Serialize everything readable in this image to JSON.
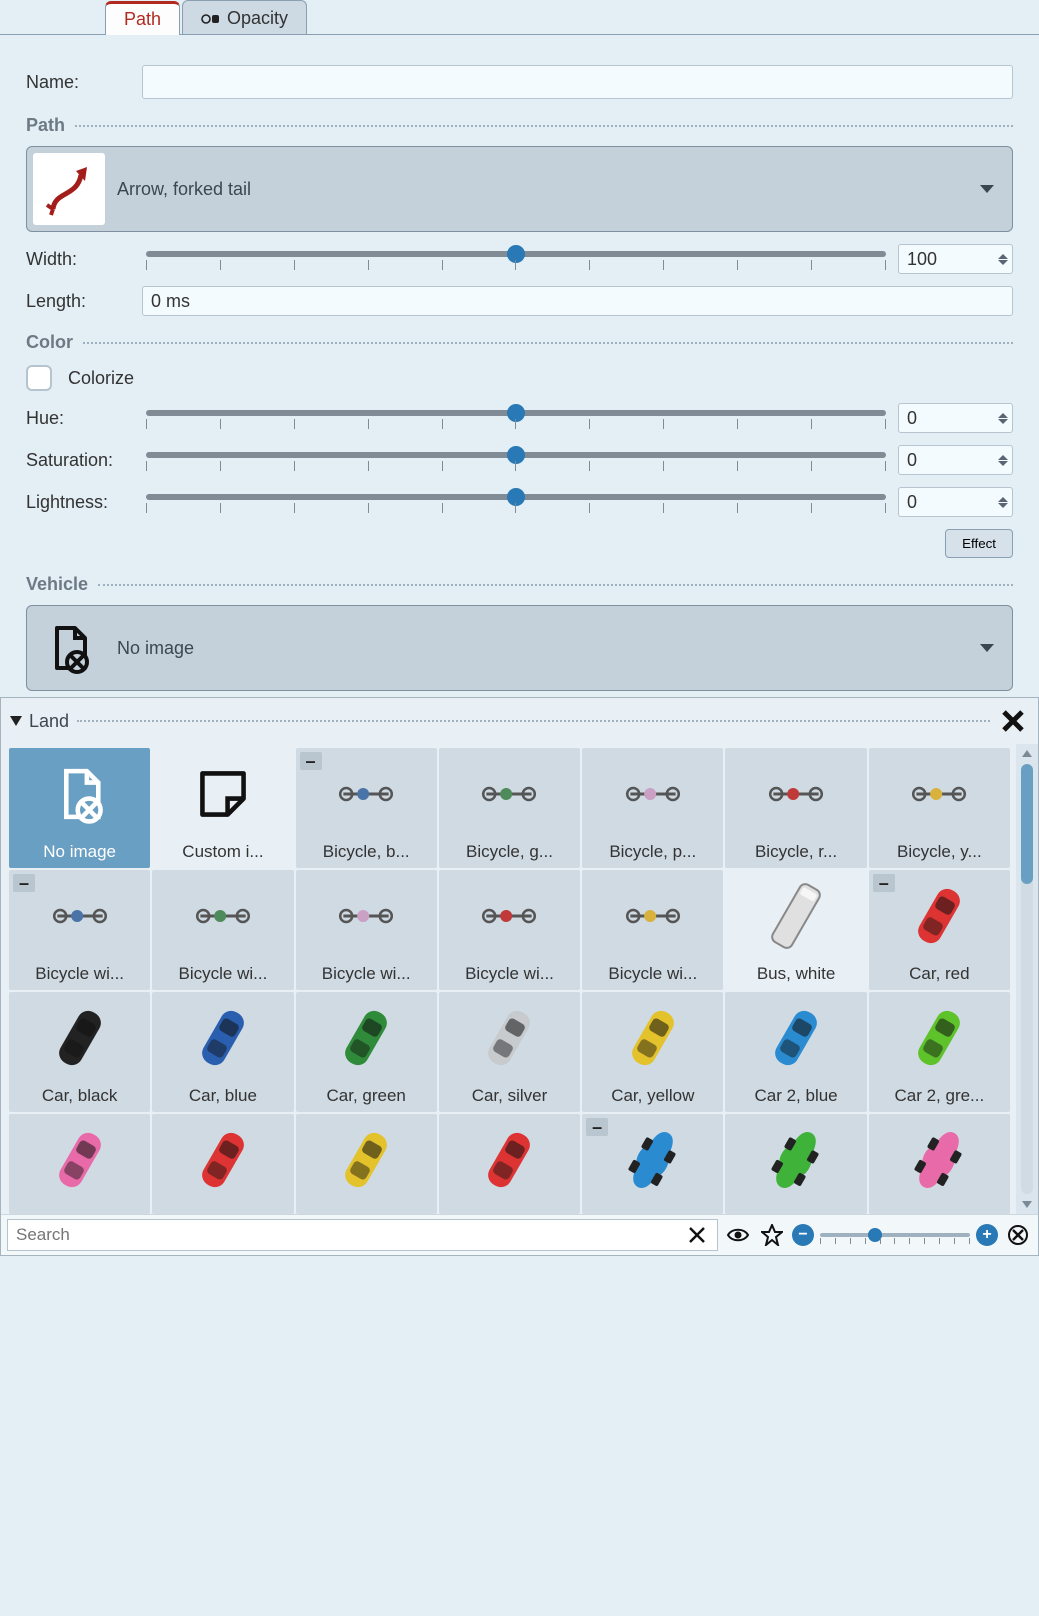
{
  "tabs": {
    "path": "Path",
    "opacity": "Opacity"
  },
  "fields": {
    "name_label": "Name:",
    "name_value": "",
    "width_label": "Width:",
    "width_value": "100",
    "length_label": "Length:",
    "length_value": "0 ms",
    "hue_label": "Hue:",
    "hue_value": "0",
    "sat_label": "Saturation:",
    "sat_value": "0",
    "light_label": "Lightness:",
    "light_value": "0",
    "colorize_label": "Colorize",
    "effect_label": "Effect"
  },
  "sections": {
    "path": "Path",
    "color": "Color",
    "vehicle": "Vehicle"
  },
  "dropdowns": {
    "path_style": "Arrow, forked tail",
    "vehicle_style": "No image"
  },
  "picker": {
    "category": "Land",
    "search_placeholder": "Search",
    "items": [
      {
        "label": "No image",
        "color": "",
        "selected": true,
        "kind": "noimage"
      },
      {
        "label": "Custom i...",
        "color": "",
        "light": true,
        "kind": "custom"
      },
      {
        "label": "Bicycle, b...",
        "color": "#4a74a8",
        "minus": true,
        "rotate": 45,
        "kind": "bike"
      },
      {
        "label": "Bicycle, g...",
        "color": "#4f8b5a",
        "rotate": 45,
        "kind": "bike"
      },
      {
        "label": "Bicycle, p...",
        "color": "#caa0c4",
        "rotate": 45,
        "kind": "bike"
      },
      {
        "label": "Bicycle, r...",
        "color": "#c03a3a",
        "rotate": 45,
        "kind": "bike"
      },
      {
        "label": "Bicycle, y...",
        "color": "#d8b23c",
        "rotate": 45,
        "kind": "bike"
      },
      {
        "label": "Bicycle wi...",
        "color": "#4a74a8",
        "minus": true,
        "rotate": 45,
        "kind": "bike"
      },
      {
        "label": "Bicycle wi...",
        "color": "#4f8b5a",
        "rotate": 45,
        "kind": "bike"
      },
      {
        "label": "Bicycle wi...",
        "color": "#caa0c4",
        "rotate": 45,
        "kind": "bike"
      },
      {
        "label": "Bicycle wi...",
        "color": "#c03a3a",
        "rotate": 45,
        "kind": "bike"
      },
      {
        "label": "Bicycle wi...",
        "color": "#d8b23c",
        "rotate": 45,
        "kind": "bike"
      },
      {
        "label": "Bus, white",
        "color": "#e0e0e0",
        "light": true,
        "rotate": 30,
        "kind": "bus"
      },
      {
        "label": "Car, red",
        "color": "#d33",
        "minus": true,
        "rotate": 30,
        "kind": "car"
      },
      {
        "label": "Car, black",
        "color": "#222",
        "rotate": 30,
        "kind": "car"
      },
      {
        "label": "Car, blue",
        "color": "#2a5fb0",
        "rotate": 30,
        "kind": "car"
      },
      {
        "label": "Car, green",
        "color": "#2f8b3a",
        "rotate": 30,
        "kind": "car"
      },
      {
        "label": "Car, silver",
        "color": "#c7cbce",
        "rotate": 30,
        "kind": "car"
      },
      {
        "label": "Car, yellow",
        "color": "#e3c22b",
        "rotate": 30,
        "kind": "car"
      },
      {
        "label": "Car 2, blue",
        "color": "#2a8bd0",
        "rotate": 30,
        "kind": "car"
      },
      {
        "label": "Car 2, gre...",
        "color": "#5ec22b",
        "rotate": 30,
        "kind": "car"
      },
      {
        "label": "",
        "color": "#e86aa8",
        "rotate": 30,
        "kind": "car"
      },
      {
        "label": "",
        "color": "#d33",
        "rotate": 30,
        "kind": "car"
      },
      {
        "label": "",
        "color": "#e3c22b",
        "rotate": 30,
        "kind": "car"
      },
      {
        "label": "",
        "color": "#d33",
        "rotate": 30,
        "kind": "car"
      },
      {
        "label": "",
        "color": "#2a8bd0",
        "minus": true,
        "rotate": 30,
        "kind": "racecar"
      },
      {
        "label": "",
        "color": "#3fb23a",
        "rotate": 30,
        "kind": "racecar"
      },
      {
        "label": "",
        "color": "#e86aa8",
        "rotate": 30,
        "kind": "racecar"
      }
    ]
  }
}
